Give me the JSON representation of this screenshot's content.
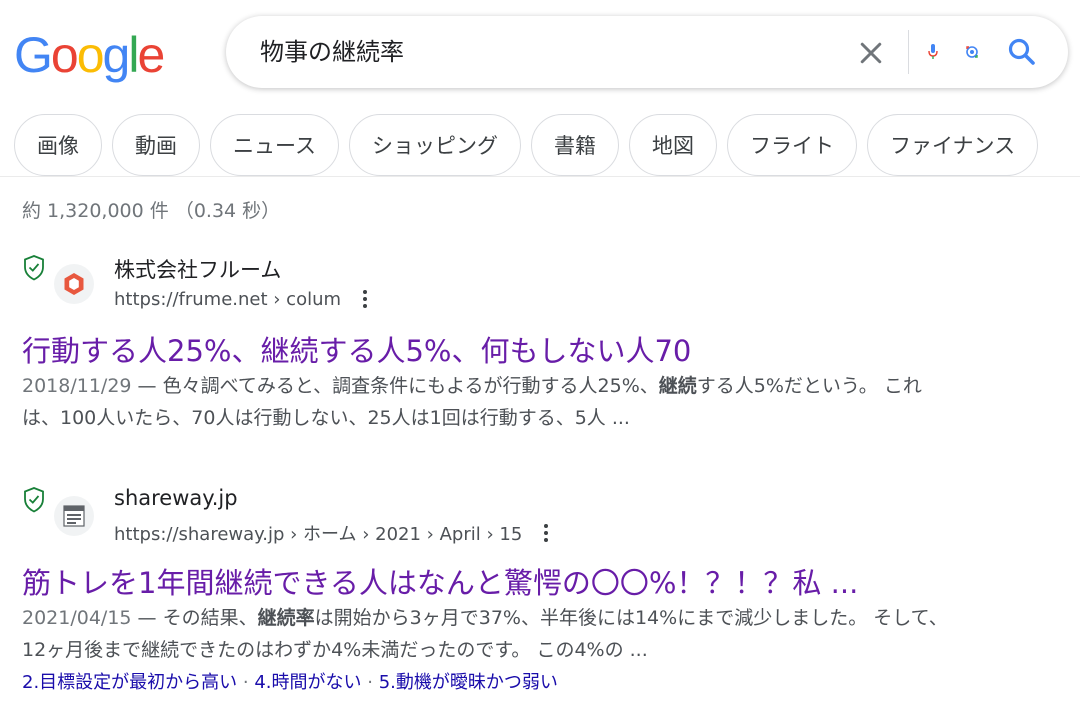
{
  "logo": {
    "letters": [
      {
        "char": "G",
        "color": "#4285F4"
      },
      {
        "char": "o",
        "color": "#EA4335"
      },
      {
        "char": "o",
        "color": "#FBBC05"
      },
      {
        "char": "g",
        "color": "#4285F4"
      },
      {
        "char": "l",
        "color": "#34A853"
      },
      {
        "char": "e",
        "color": "#EA4335"
      }
    ]
  },
  "search": {
    "query": "物事の継続率"
  },
  "chips": [
    "画像",
    "動画",
    "ニュース",
    "ショッピング",
    "書籍",
    "地図",
    "フライト",
    "ファイナンス"
  ],
  "stats": "約 1,320,000 件 （0.34 秒）",
  "results": [
    {
      "site_name": "株式会社フルーム",
      "url": "https://frume.net › colum",
      "title": "行動する人25%、継続する人5%、何もしない人70",
      "date": "2018/11/29",
      "dash": " — ",
      "snippet_1": "色々調べてみると、調査条件にもよるが行動する人25%、",
      "bold_1": "継続",
      "snippet_2": "する人5%だという。 これは、100人いたら、70人は行動しない、25人は1回は行動する、5人 ..."
    },
    {
      "site_name": "shareway.jp",
      "url": "https://shareway.jp › ホーム › 2021 › April › 15",
      "title": "筋トレを1年間継続できる人はなんと驚愕の〇〇%！？！？私 ...",
      "date": "2021/04/15",
      "dash": " — ",
      "snippet_1": "その結果、",
      "bold_1": "継続率",
      "snippet_2": "は開始から3ヶ月で37%、半年後には14%にまで減少しました。 そして、12ヶ月後まで継続できたのはわずか4%未満だったのです。 この4%の ...",
      "sitelinks": [
        "2.目標設定が最初から高い",
        "4.時間がない",
        "5.動機が曖昧かつ弱い"
      ],
      "sitelink_sep": " · "
    }
  ],
  "colors": {
    "visited_title": "#681da8",
    "link_blue": "#1a0dab",
    "shield_green": "#188038",
    "search_blue": "#4285F4"
  }
}
